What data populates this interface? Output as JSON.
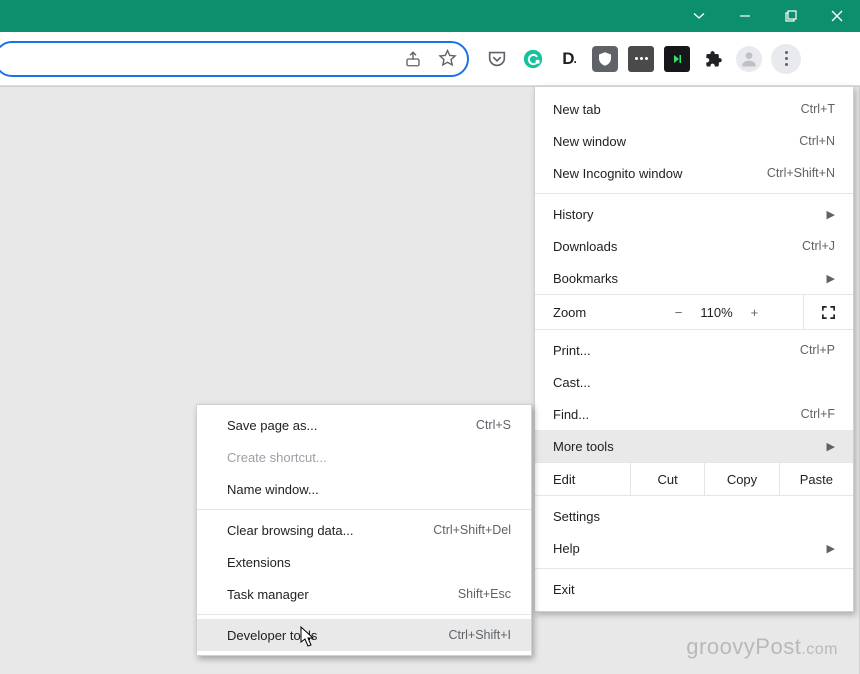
{
  "titlebar": {
    "accent": "#0c8f6c"
  },
  "menu": {
    "new_tab": {
      "label": "New tab",
      "shortcut": "Ctrl+T"
    },
    "new_window": {
      "label": "New window",
      "shortcut": "Ctrl+N"
    },
    "new_incognito": {
      "label": "New Incognito window",
      "shortcut": "Ctrl+Shift+N"
    },
    "history": {
      "label": "History"
    },
    "downloads": {
      "label": "Downloads",
      "shortcut": "Ctrl+J"
    },
    "bookmarks": {
      "label": "Bookmarks"
    },
    "zoom": {
      "label": "Zoom",
      "minus": "−",
      "value": "110%",
      "plus": "+"
    },
    "print": {
      "label": "Print...",
      "shortcut": "Ctrl+P"
    },
    "cast": {
      "label": "Cast..."
    },
    "find": {
      "label": "Find...",
      "shortcut": "Ctrl+F"
    },
    "more_tools": {
      "label": "More tools"
    },
    "edit": {
      "label": "Edit",
      "cut": "Cut",
      "copy": "Copy",
      "paste": "Paste"
    },
    "settings": {
      "label": "Settings"
    },
    "help": {
      "label": "Help"
    },
    "exit": {
      "label": "Exit"
    }
  },
  "submenu": {
    "save_page": {
      "label": "Save page as...",
      "shortcut": "Ctrl+S"
    },
    "create_shortcut": {
      "label": "Create shortcut..."
    },
    "name_window": {
      "label": "Name window..."
    },
    "clear_data": {
      "label": "Clear browsing data...",
      "shortcut": "Ctrl+Shift+Del"
    },
    "extensions": {
      "label": "Extensions"
    },
    "task_manager": {
      "label": "Task manager",
      "shortcut": "Shift+Esc"
    },
    "dev_tools": {
      "label": "Developer tools",
      "shortcut": "Ctrl+Shift+I"
    }
  },
  "watermark": {
    "text": "groovyPost",
    "ext": ".com"
  }
}
